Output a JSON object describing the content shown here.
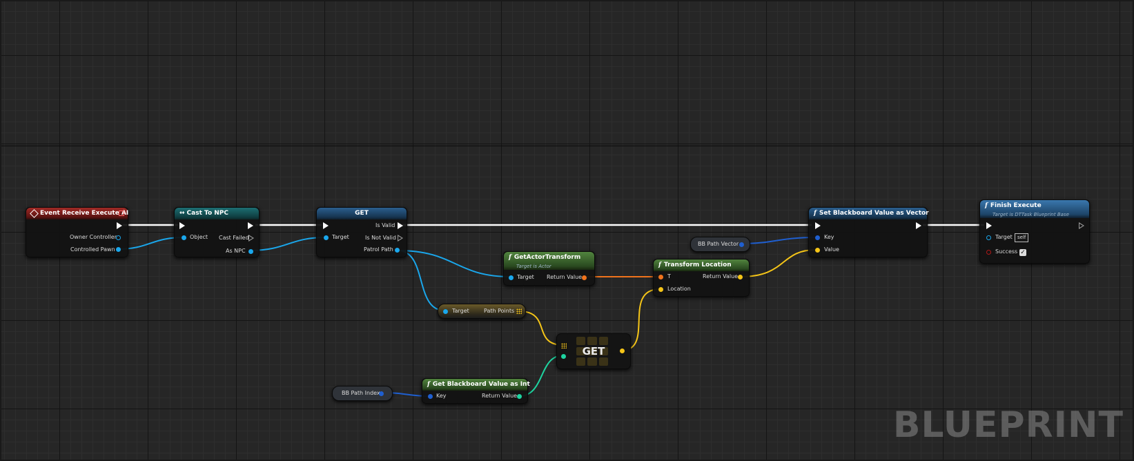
{
  "editor": {
    "watermark": "BLUEPRINT"
  },
  "colors": {
    "exec_wire": "#ffffff",
    "object_wire": "#1aa7ec",
    "transform_wire": "#f0731c",
    "vector_wire": "#f5c518",
    "int_wire": "#1ed4a0",
    "key_wire": "#1f5fd0"
  },
  "nodes": {
    "event_receive": {
      "title": "Event Receive Execute AI",
      "pins": [
        "Owner Controller",
        "Controlled Pawn"
      ]
    },
    "cast_to_npc": {
      "title": "Cast To NPC",
      "pins": [
        "Object",
        "Cast Failed",
        "As NPC"
      ]
    },
    "validated_get": {
      "title": "GET",
      "pins": [
        "Target",
        "Is Valid",
        "Is Not Valid",
        "Patrol Path"
      ]
    },
    "get_actor_transform": {
      "title": "GetActorTransform",
      "subtitle": "Target is Actor",
      "pins": [
        "Target",
        "Return Value"
      ]
    },
    "path_points": {
      "pins": [
        "Target",
        "Path Points"
      ]
    },
    "array_get": {
      "title": "GET"
    },
    "get_bb_int": {
      "title": "Get Blackboard Value as Int",
      "pins": [
        "Key",
        "Return Value"
      ]
    },
    "bb_path_index": {
      "label": "BB Path Index"
    },
    "transform_location": {
      "title": "Transform Location",
      "pins": [
        "T",
        "Return Value",
        "Location"
      ]
    },
    "bb_path_vector": {
      "label": "BB Path Vector"
    },
    "set_bb_vector": {
      "title": "Set Blackboard Value as Vector",
      "pins": [
        "Key",
        "Value"
      ]
    },
    "finish_execute": {
      "title": "Finish Execute",
      "subtitle": "Target is DTTask Blueprint Base",
      "pins": [
        "Target",
        "Success"
      ],
      "target_default": "self",
      "success_checked": true
    }
  }
}
